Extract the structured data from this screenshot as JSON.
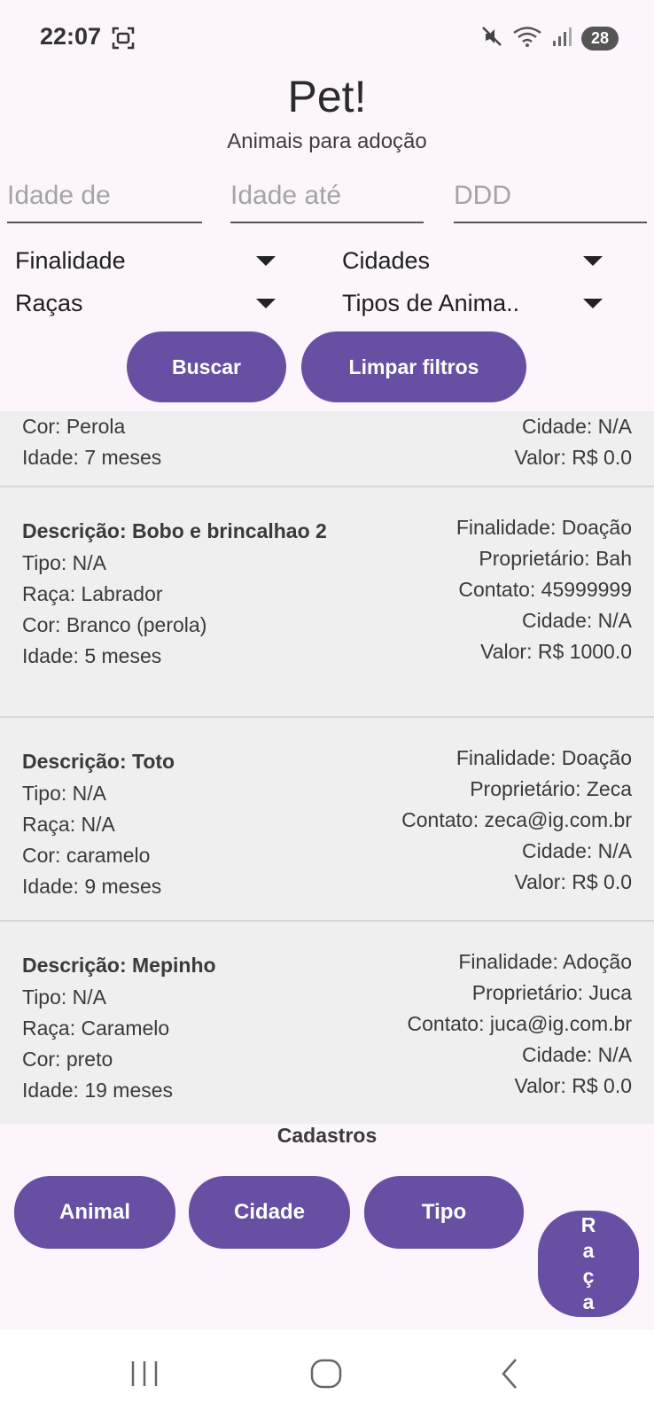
{
  "status_bar": {
    "time": "22:07",
    "battery": "28"
  },
  "header": {
    "title": "Pet!",
    "subtitle": "Animais para adoção"
  },
  "filters": {
    "idade_de_placeholder": "Idade de",
    "idade_ate_placeholder": "Idade até",
    "ddd_placeholder": "DDD",
    "finalidade": "Finalidade",
    "cidades": "Cidades",
    "racas": "Raças",
    "tipos": "Tipos de Anima..",
    "buscar_label": "Buscar",
    "limpar_label": "Limpar filtros"
  },
  "cards": [
    {
      "left": [
        "Cor: Perola",
        "Idade: 7 meses"
      ],
      "right": [
        "Cidade: N/A",
        "Valor: R$ 0.0"
      ]
    },
    {
      "description": "Descrição: Bobo e brincalhao 2",
      "left": [
        "Tipo: N/A",
        "Raça: Labrador",
        "Cor: Branco (perola)",
        "Idade: 5 meses"
      ],
      "right": [
        "Finalidade: Doação",
        "Proprietário: Bah",
        "Contato: 45999999",
        "Cidade: N/A",
        "Valor: R$ 1000.0"
      ]
    },
    {
      "description": "Descrição: Toto",
      "left": [
        "Tipo: N/A",
        "Raça: N/A",
        "Cor: caramelo",
        "Idade: 9 meses"
      ],
      "right": [
        "Finalidade: Doação",
        "Proprietário: Zeca",
        "Contato: zeca@ig.com.br",
        "Cidade: N/A",
        "Valor: R$ 0.0"
      ]
    },
    {
      "description": "Descrição: Mepinho",
      "left": [
        "Tipo: N/A",
        "Raça: Caramelo",
        "Cor: preto",
        "Idade: 19 meses"
      ],
      "right": [
        "Finalidade: Adoção",
        "Proprietário: Juca",
        "Contato: juca@ig.com.br",
        "Cidade: N/A",
        "Valor: R$ 0.0"
      ]
    }
  ],
  "cadastros": {
    "title": "Cadastros",
    "animal": "Animal",
    "cidade": "Cidade",
    "tipo": "Tipo",
    "raca": [
      "R",
      "a",
      "ç",
      "a"
    ]
  },
  "colors": {
    "accent": "#6750a4",
    "background": "#fdf5fc",
    "card_bg": "#efefef"
  },
  "icons": [
    "screen-record-icon",
    "mute-icon",
    "wifi-icon",
    "signal-icon",
    "recents-icon",
    "home-icon",
    "back-icon"
  ]
}
